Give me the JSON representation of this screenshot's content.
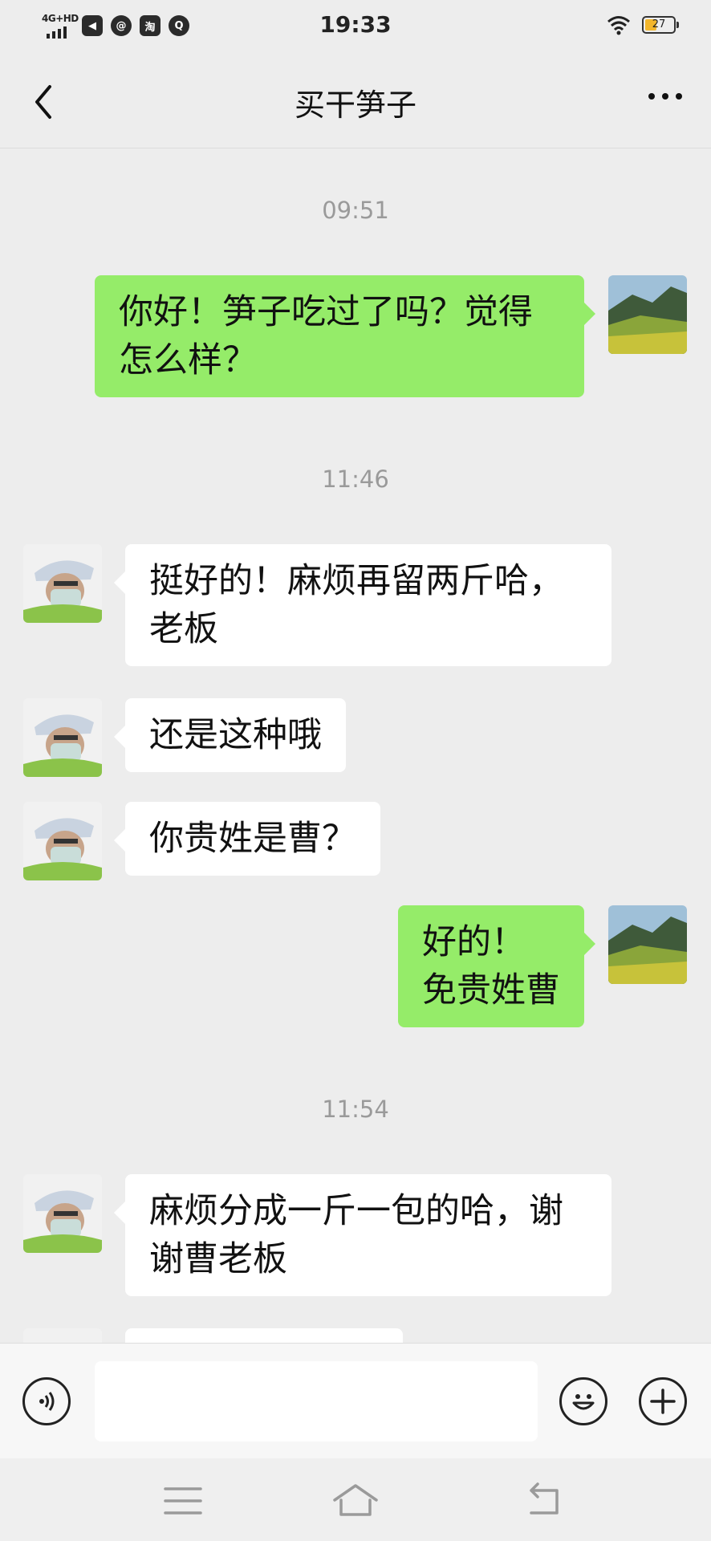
{
  "status_bar": {
    "network": "4G+HD",
    "time": "19:33",
    "battery_level": "27",
    "app_icons": [
      "telegram-icon",
      "qq-mail-icon",
      "taobao-icon",
      "browser-icon"
    ],
    "app_icon_glyphs": [
      "◀",
      "@",
      "淘",
      "Q"
    ]
  },
  "header": {
    "title": "买干笋子",
    "back_icon": "chevron-left-icon",
    "more_icon": "more-dots-icon"
  },
  "messages": [
    {
      "type": "time",
      "text": "09:51"
    },
    {
      "type": "msg",
      "side": "out",
      "text": "你好！笋子吃过了吗？觉得\n怎么样？"
    },
    {
      "type": "time",
      "text": "11:46"
    },
    {
      "type": "msg",
      "side": "in",
      "text": "挺好的！麻烦再留两斤哈，\n老板"
    },
    {
      "type": "msg",
      "side": "in",
      "text": "还是这种哦"
    },
    {
      "type": "msg",
      "side": "in",
      "text": "你贵姓是曹？"
    },
    {
      "type": "msg",
      "side": "out",
      "text": "好的！\n免贵姓曹"
    },
    {
      "type": "time",
      "text": "11:54"
    },
    {
      "type": "msg",
      "side": "in",
      "text": "麻烦分成一斤一包的哈，谢\n谢曹老板"
    },
    {
      "type": "msg",
      "side": "in",
      "text": ""
    }
  ],
  "input_bar": {
    "value": "",
    "voice_icon": "voice-icon",
    "emoji_icon": "emoji-icon",
    "plus_icon": "plus-icon"
  },
  "system_nav": {
    "icons": [
      "menu-icon",
      "home-icon",
      "back-icon"
    ]
  },
  "colors": {
    "background": "#ededed",
    "outgoing_bubble": "#95ec69",
    "incoming_bubble": "#ffffff",
    "timestamp_text": "#9a9a9a"
  }
}
